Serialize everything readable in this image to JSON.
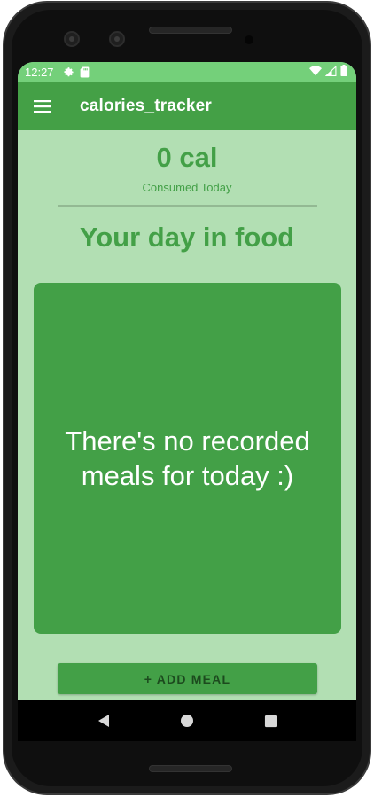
{
  "status_bar": {
    "time": "12:27",
    "icons": [
      "settings-gear-icon",
      "sd-card-icon",
      "wifi-icon",
      "signal-icon",
      "battery-icon"
    ]
  },
  "app_bar": {
    "title": "calories_tracker",
    "menu_icon": "hamburger-menu-icon"
  },
  "summary": {
    "calories": "0 cal",
    "label": "Consumed Today"
  },
  "section": {
    "title": "Your day in food"
  },
  "meals": {
    "empty_message": "There's no recorded meals for today :)"
  },
  "actions": {
    "add_meal_label": "+ ADD MEAL"
  },
  "nav_bar": {
    "buttons": [
      "back-icon",
      "home-icon",
      "recents-icon"
    ]
  },
  "colors": {
    "primary": "#43a047",
    "status_bar": "#74d07a",
    "background": "#b2dfb3",
    "button_text": "#1c4a1e"
  }
}
